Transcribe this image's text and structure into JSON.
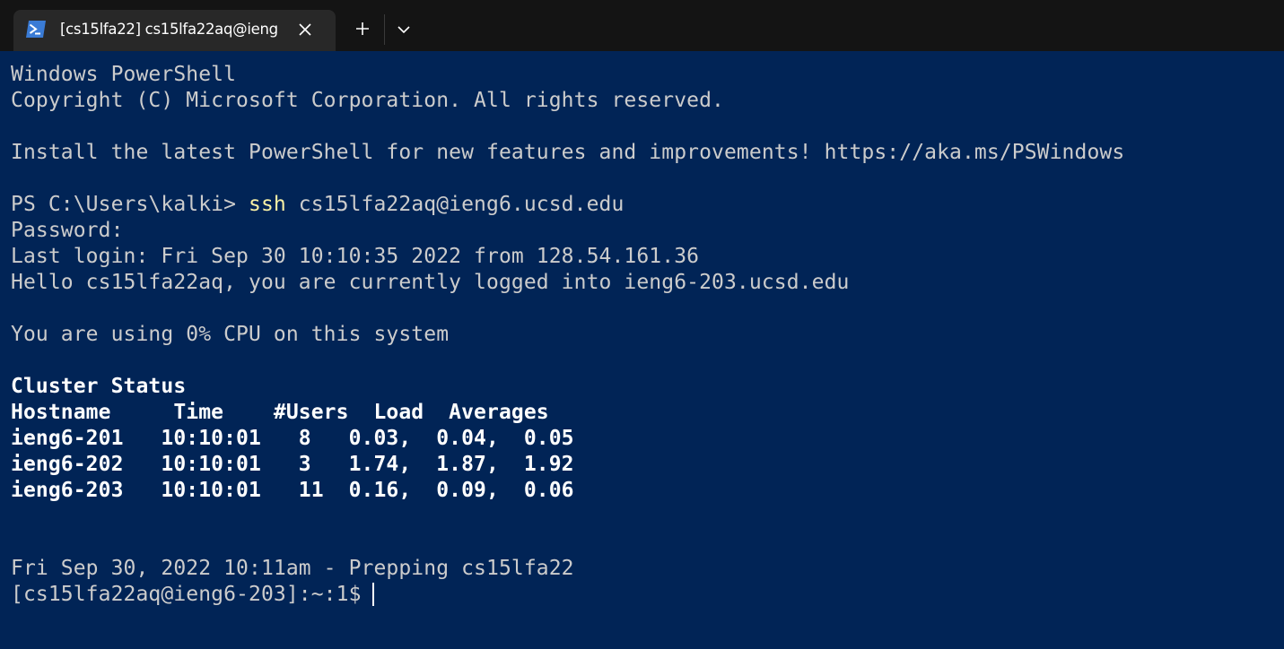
{
  "tab": {
    "icon": "powershell-icon",
    "title": "[cs15lfa22]  cs15lfa22aq@ieng"
  },
  "titlebar": {
    "new_tab_icon": "plus-icon",
    "dropdown_icon": "chevron-down-icon",
    "close_icon": "close-icon"
  },
  "colors": {
    "terminal_bg": "#012456",
    "titlebar_bg": "#141414",
    "tab_bg": "#282828",
    "text": "#cccccc",
    "command": "#f9f1a5"
  },
  "terminal": {
    "banner_1": "Windows PowerShell",
    "banner_2": "Copyright (C) Microsoft Corporation. All rights reserved.",
    "install_msg": "Install the latest PowerShell for new features and improvements! https://aka.ms/PSWindows",
    "prompt": "PS C:\\Users\\kalki> ",
    "command": "ssh",
    "command_args": " cs15lfa22aq@ieng6.ucsd.edu",
    "password": "Password:",
    "last_login": "Last login: Fri Sep 30 10:10:35 2022 from 128.54.161.36",
    "hello": "Hello cs15lfa22aq, you are currently logged into ieng6-203.ucsd.edu",
    "cpu": "You are using 0% CPU on this system",
    "cluster_title": "Cluster Status",
    "cluster_header": "Hostname     Time    #Users  Load  Averages",
    "cluster_rows": [
      "ieng6-201   10:10:01   8   0.03,  0.04,  0.05",
      "ieng6-202   10:10:01   3   1.74,  1.87,  1.92",
      "ieng6-203   10:10:01   11  0.16,  0.09,  0.06"
    ],
    "prep": "Fri Sep 30, 2022 10:11am - Prepping cs15lfa22",
    "shell_prompt": "[cs15lfa22aq@ieng6-203]:~:1$"
  }
}
